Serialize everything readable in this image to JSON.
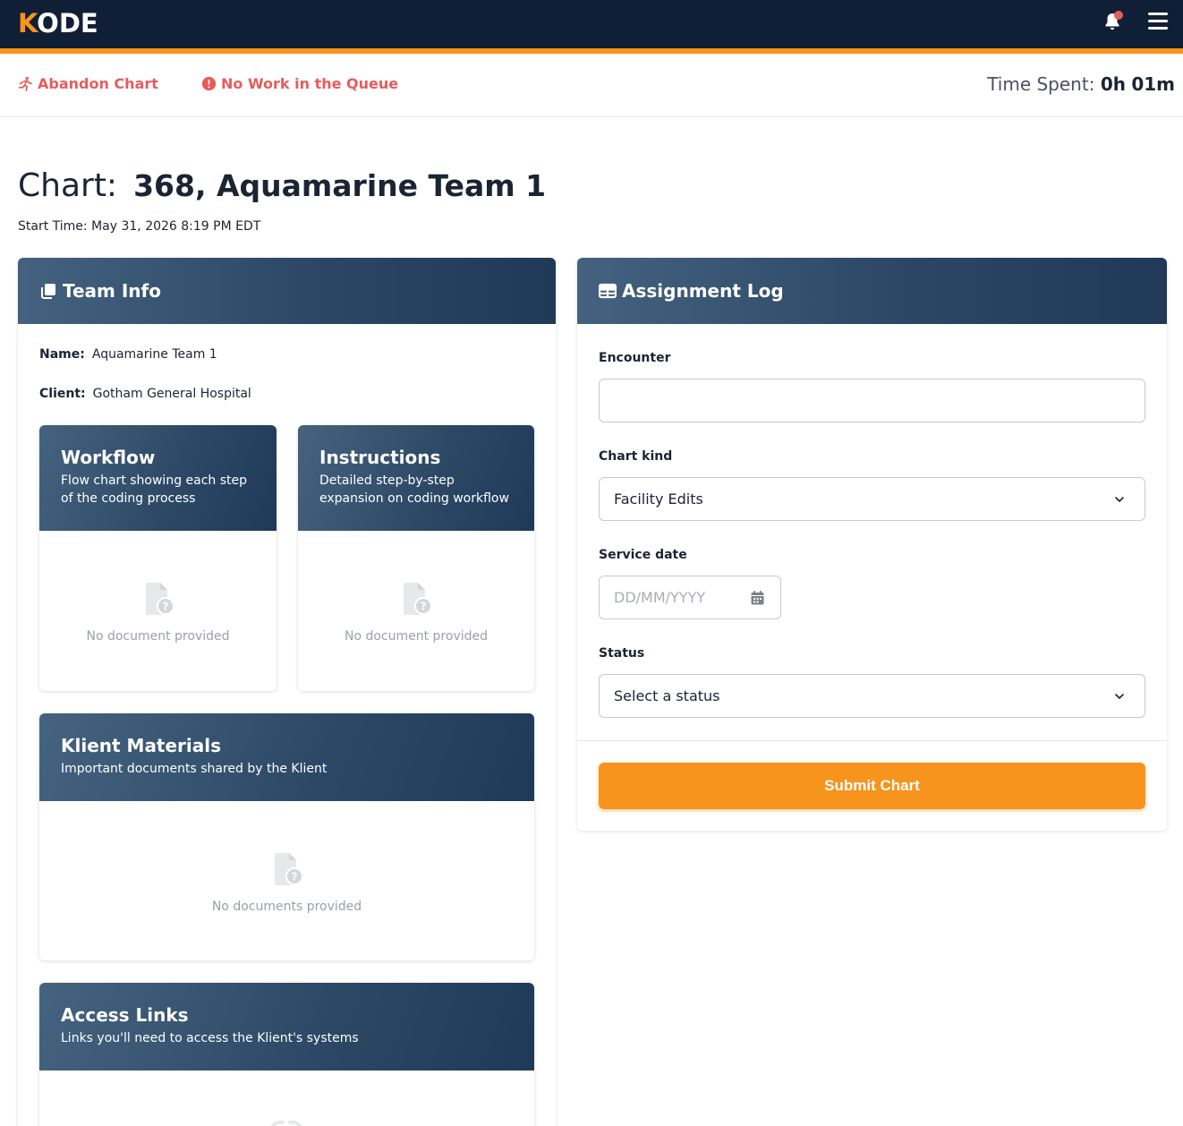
{
  "brand": {
    "logo_k": "K",
    "logo_rest": "ODE",
    "accent": "#f7941d",
    "nav_bg": "#111f36",
    "alert_color": "#e95b5b"
  },
  "actions": {
    "abandon_label": "Abandon Chart",
    "abandon_icon": "running-person-icon",
    "no_work_label": "No Work in the Queue",
    "no_work_icon": "alert-circle-icon"
  },
  "time_spent": {
    "label": "Time Spent:",
    "hours": "0h",
    "minutes": "01m"
  },
  "chart": {
    "label": "Chart:",
    "value": "368, Aquamarine Team 1",
    "start_time": "Start Time: May 31, 2026 8:19 PM EDT"
  },
  "team_info": {
    "title": "Team Info",
    "name_label": "Name:",
    "name_value": "Aquamarine Team 1",
    "client_label": "Client:",
    "client_value": "Gotham General Hospital",
    "cards": {
      "workflow": {
        "title": "Workflow",
        "subtitle": "Flow chart showing each step of the coding process",
        "empty": "No document provided"
      },
      "instructions": {
        "title": "Instructions",
        "subtitle": "Detailed step-by-step expansion on coding workflow",
        "empty": "No document provided"
      },
      "materials": {
        "title": "Klient Materials",
        "subtitle": "Important documents shared by the Klient",
        "empty": "No documents provided"
      },
      "links": {
        "title": "Access Links",
        "subtitle": "Links you'll need to access the Klient's systems"
      }
    }
  },
  "assignment": {
    "title": "Assignment Log",
    "encounter_label": "Encounter",
    "encounter_value": "",
    "chart_kind_label": "Chart kind",
    "chart_kind_value": "Facility Edits",
    "service_date_label": "Service date",
    "service_date_placeholder": "DD/MM/YYYY",
    "status_label": "Status",
    "status_value": "Select a status",
    "submit_label": "Submit Chart"
  }
}
